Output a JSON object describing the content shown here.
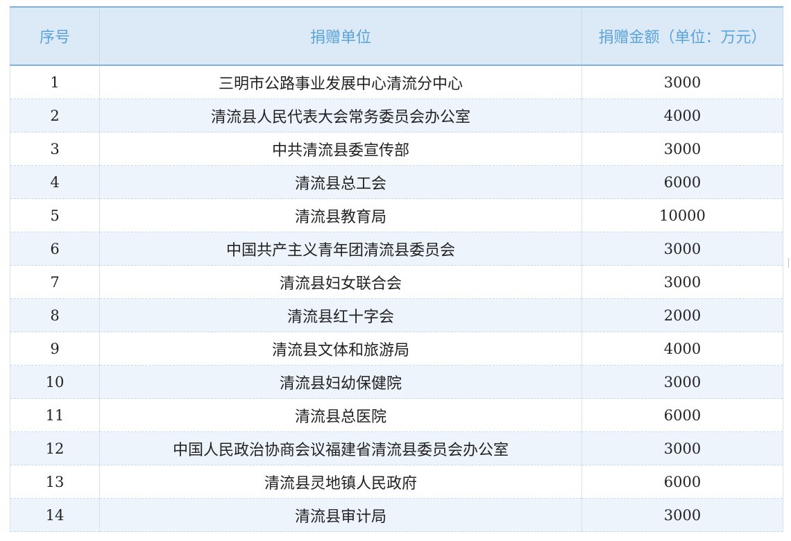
{
  "table": {
    "headers": {
      "index": "序号",
      "unit": "捐赠单位",
      "amount": "捐赠金额（单位：万元）"
    },
    "rows": [
      {
        "index": "1",
        "unit": "三明市公路事业发展中心清流分中心",
        "amount": "3000"
      },
      {
        "index": "2",
        "unit": "清流县人民代表大会常务委员会办公室",
        "amount": "4000"
      },
      {
        "index": "3",
        "unit": "中共清流县委宣传部",
        "amount": "3000"
      },
      {
        "index": "4",
        "unit": "清流县总工会",
        "amount": "6000"
      },
      {
        "index": "5",
        "unit": "清流县教育局",
        "amount": "10000"
      },
      {
        "index": "6",
        "unit": "中国共产主义青年团清流县委员会",
        "amount": "3000"
      },
      {
        "index": "7",
        "unit": "清流县妇女联合会",
        "amount": "3000"
      },
      {
        "index": "8",
        "unit": "清流县红十字会",
        "amount": "2000"
      },
      {
        "index": "9",
        "unit": "清流县文体和旅游局",
        "amount": "4000"
      },
      {
        "index": "10",
        "unit": "清流县妇幼保健院",
        "amount": "3000"
      },
      {
        "index": "11",
        "unit": "清流县总医院",
        "amount": "6000"
      },
      {
        "index": "12",
        "unit": "中国人民政治协商会议福建省清流县委员会办公室",
        "amount": "3000"
      },
      {
        "index": "13",
        "unit": "清流县灵地镇人民政府",
        "amount": "6000"
      },
      {
        "index": "14",
        "unit": "清流县审计局",
        "amount": "3000"
      }
    ]
  }
}
